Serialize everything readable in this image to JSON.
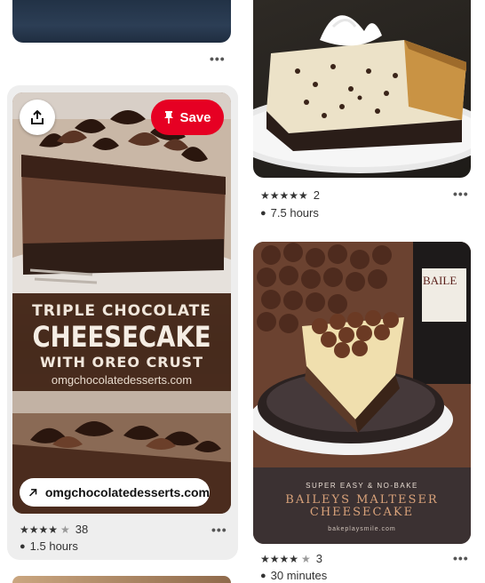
{
  "pins": [
    {
      "id": "top-left",
      "more_label": "•••"
    },
    {
      "id": "triple-chocolate",
      "overlay_title": [
        "TRIPLE CHOCOLATE",
        "CHEESECAKE",
        "WITH OREO CRUST"
      ],
      "overlay_site": "omgchocolatedesserts.com",
      "save_label": "Save",
      "link_label": "omgchocolatedesserts.com",
      "rating": {
        "stars": 4.5,
        "count": "38"
      },
      "time": "1.5 hours",
      "more_label": "•••"
    },
    {
      "id": "chocolate-chip-cheesecake",
      "rating": {
        "stars": 5,
        "count": "2"
      },
      "time": "7.5 hours",
      "more_label": "•••"
    },
    {
      "id": "baileys-malteser",
      "overlay_kicker": "SUPER EASY & NO-BAKE",
      "overlay_title": [
        "BAILEYS MALTESER",
        "CHEESECAKE"
      ],
      "overlay_site": "bakeplaysmile.com",
      "bottle_text": "BAILE",
      "rating": {
        "stars": 4.5,
        "count": "3"
      },
      "time": "30 minutes",
      "more_label": "•••"
    }
  ],
  "icons": {
    "share": "share-icon",
    "pin": "pushpin-icon",
    "link": "arrow-up-right-icon",
    "clock": "clock-icon",
    "star": "star-icon"
  },
  "colors": {
    "save_button": "#e60023",
    "hover_card_bg": "#eeeeee"
  }
}
